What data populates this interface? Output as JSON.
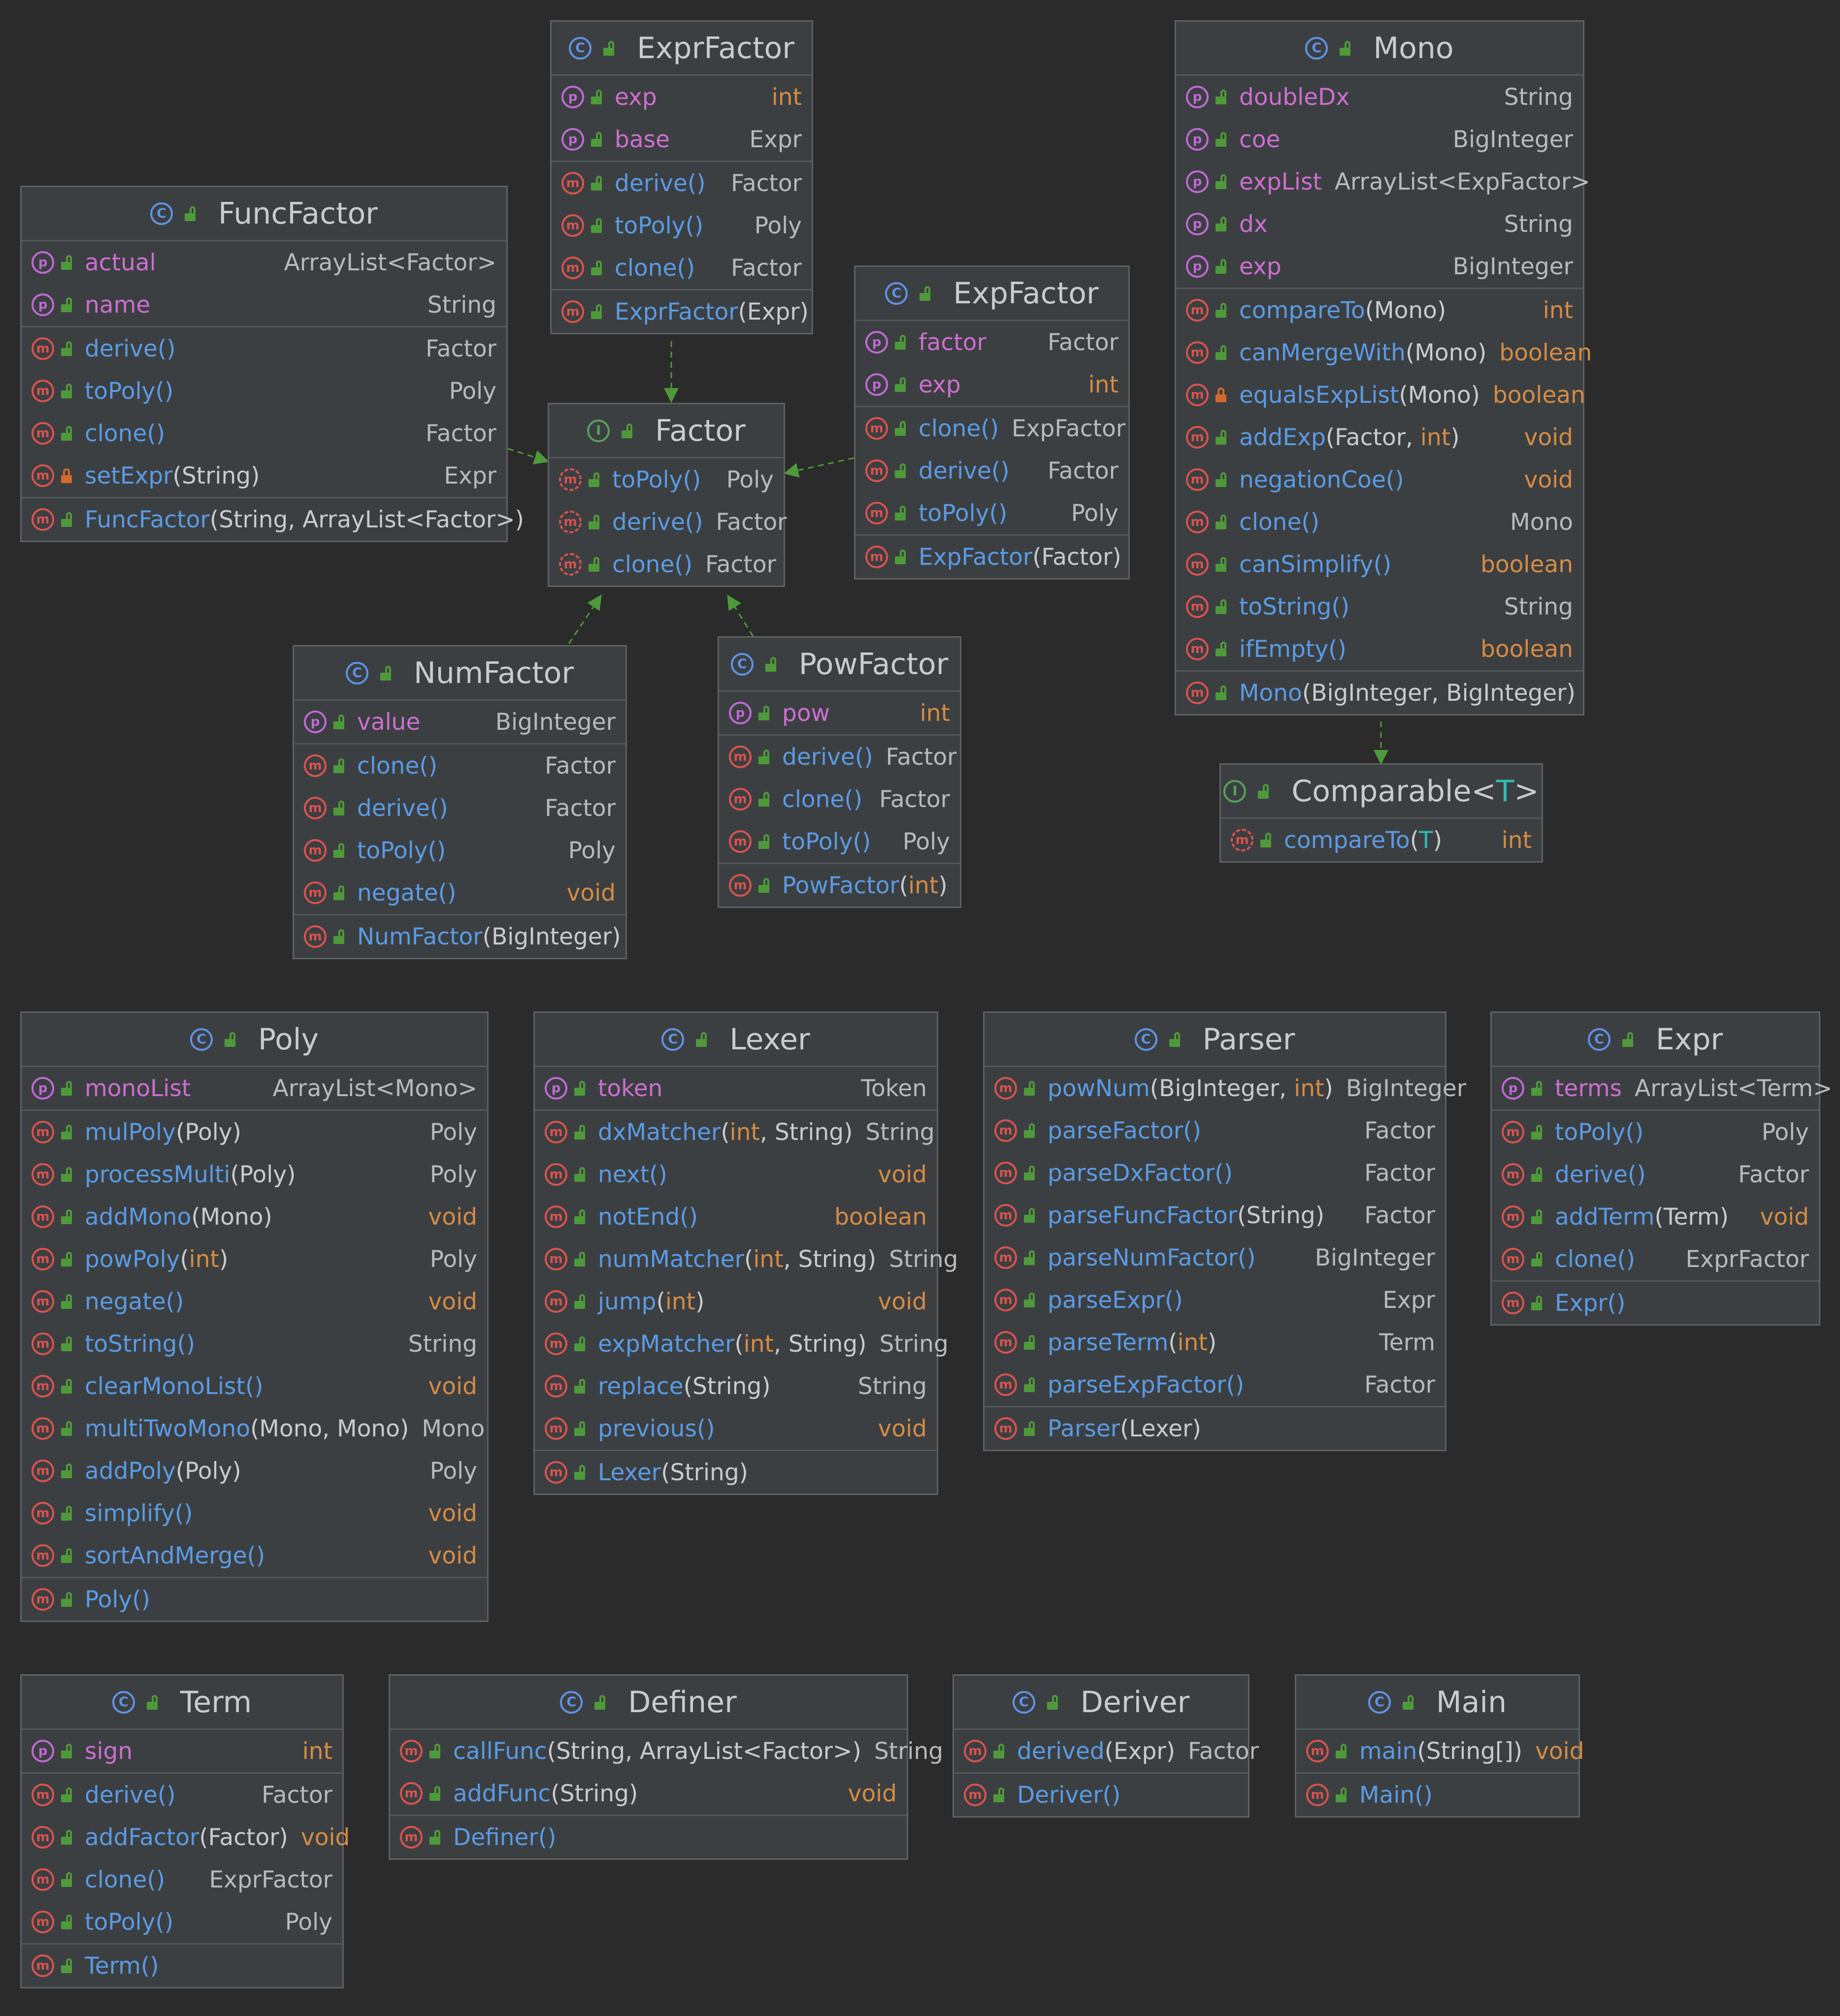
{
  "colors": {
    "background": "#2b2b2b",
    "node": "#3c3f41",
    "class_icon": "#5f93e6",
    "interface_icon": "#58a15a",
    "field_icon": "#c06ad6",
    "method_icon": "#d9534f",
    "method_name": "#5a9be5",
    "field_name": "#cd6fd0",
    "keyword": "#d58c45",
    "edge": "#4e9a3a"
  },
  "icons": {
    "class": "class-icon",
    "interface": "interface-icon",
    "field": "property-icon",
    "method": "method-icon",
    "public": "public-lock-icon",
    "private": "private-lock-icon"
  },
  "nodes": {
    "ExprFactor": {
      "kind": "class",
      "title": "ExprFactor",
      "sections": [
        [
          {
            "k": "p",
            "name": "exp",
            "type": "int"
          },
          {
            "k": "p",
            "name": "base",
            "type": "Expr"
          }
        ],
        [
          {
            "k": "m",
            "name": "derive()",
            "type": "Factor"
          },
          {
            "k": "m",
            "name": "toPoly()",
            "type": "Poly"
          },
          {
            "k": "m",
            "name": "clone()",
            "type": "Factor"
          }
        ],
        [
          {
            "k": "m",
            "name": "ExprFactor",
            "params": "(Expr)",
            "type": ""
          }
        ]
      ]
    },
    "Mono": {
      "kind": "class",
      "title": "Mono",
      "sections": [
        [
          {
            "k": "p",
            "name": "doubleDx",
            "type": "String"
          },
          {
            "k": "p",
            "name": "coe",
            "type": "BigInteger"
          },
          {
            "k": "p",
            "name": "expList",
            "type": "ArrayList<ExpFactor>"
          },
          {
            "k": "p",
            "name": "dx",
            "type": "String"
          },
          {
            "k": "p",
            "name": "exp",
            "type": "BigInteger"
          }
        ],
        [
          {
            "k": "m",
            "name": "compareTo",
            "params": "(Mono)",
            "type": "int"
          },
          {
            "k": "m",
            "name": "canMergeWith",
            "params": "(Mono)",
            "type": "boolean"
          },
          {
            "k": "m",
            "name": "equalsExpList",
            "params": "(Mono)",
            "type": "boolean",
            "private": true
          },
          {
            "k": "m",
            "name": "addExp",
            "params": "(Factor, int)",
            "type": "void"
          },
          {
            "k": "m",
            "name": "negationCoe()",
            "type": "void"
          },
          {
            "k": "m",
            "name": "clone()",
            "type": "Mono"
          },
          {
            "k": "m",
            "name": "canSimplify()",
            "type": "boolean"
          },
          {
            "k": "m",
            "name": "toString()",
            "type": "String"
          },
          {
            "k": "m",
            "name": "ifEmpty()",
            "type": "boolean"
          }
        ],
        [
          {
            "k": "m",
            "name": "Mono",
            "params": "(BigInteger, BigInteger)",
            "type": ""
          }
        ]
      ]
    },
    "FuncFactor": {
      "kind": "class",
      "title": "FuncFactor",
      "sections": [
        [
          {
            "k": "p",
            "name": "actual",
            "type": "ArrayList<Factor>"
          },
          {
            "k": "p",
            "name": "name",
            "type": "String"
          }
        ],
        [
          {
            "k": "m",
            "name": "derive()",
            "type": "Factor"
          },
          {
            "k": "m",
            "name": "toPoly()",
            "type": "Poly"
          },
          {
            "k": "m",
            "name": "clone()",
            "type": "Factor"
          },
          {
            "k": "m",
            "name": "setExpr",
            "params": "(String)",
            "type": "Expr",
            "private": true
          }
        ],
        [
          {
            "k": "m",
            "name": "FuncFactor",
            "params": "(String, ArrayList<Factor>)",
            "type": ""
          }
        ]
      ]
    },
    "ExpFactor": {
      "kind": "class",
      "title": "ExpFactor",
      "sections": [
        [
          {
            "k": "p",
            "name": "factor",
            "type": "Factor"
          },
          {
            "k": "p",
            "name": "exp",
            "type": "int"
          }
        ],
        [
          {
            "k": "m",
            "name": "clone()",
            "type": "ExpFactor"
          },
          {
            "k": "m",
            "name": "derive()",
            "type": "Factor"
          },
          {
            "k": "m",
            "name": "toPoly()",
            "type": "Poly"
          }
        ],
        [
          {
            "k": "m",
            "name": "ExpFactor",
            "params": "(Factor)",
            "type": ""
          }
        ]
      ]
    },
    "Factor": {
      "kind": "interface",
      "title": "Factor",
      "sections": [
        [
          {
            "k": "m",
            "name": "toPoly()",
            "type": "Poly",
            "abstract": true
          },
          {
            "k": "m",
            "name": "derive()",
            "type": "Factor",
            "abstract": true
          },
          {
            "k": "m",
            "name": "clone()",
            "type": "Factor",
            "abstract": true
          }
        ]
      ]
    },
    "NumFactor": {
      "kind": "class",
      "title": "NumFactor",
      "sections": [
        [
          {
            "k": "p",
            "name": "value",
            "type": "BigInteger"
          }
        ],
        [
          {
            "k": "m",
            "name": "clone()",
            "type": "Factor"
          },
          {
            "k": "m",
            "name": "derive()",
            "type": "Factor"
          },
          {
            "k": "m",
            "name": "toPoly()",
            "type": "Poly"
          },
          {
            "k": "m",
            "name": "negate()",
            "type": "void"
          }
        ],
        [
          {
            "k": "m",
            "name": "NumFactor",
            "params": "(BigInteger)",
            "type": ""
          }
        ]
      ]
    },
    "PowFactor": {
      "kind": "class",
      "title": "PowFactor",
      "sections": [
        [
          {
            "k": "p",
            "name": "pow",
            "type": "int"
          }
        ],
        [
          {
            "k": "m",
            "name": "derive()",
            "type": "Factor"
          },
          {
            "k": "m",
            "name": "clone()",
            "type": "Factor"
          },
          {
            "k": "m",
            "name": "toPoly()",
            "type": "Poly"
          }
        ],
        [
          {
            "k": "m",
            "name": "PowFactor",
            "params": "(int)",
            "type": ""
          }
        ]
      ]
    },
    "Comparable": {
      "kind": "interface",
      "title": "Comparable<",
      "tparam": "T",
      "title_end": ">",
      "sections": [
        [
          {
            "k": "m",
            "name": "compareTo",
            "params": "(T)",
            "type": "int",
            "abstract": true
          }
        ]
      ]
    },
    "Poly": {
      "kind": "class",
      "title": "Poly",
      "sections": [
        [
          {
            "k": "p",
            "name": "monoList",
            "type": "ArrayList<Mono>"
          }
        ],
        [
          {
            "k": "m",
            "name": "mulPoly",
            "params": "(Poly)",
            "type": "Poly"
          },
          {
            "k": "m",
            "name": "processMulti",
            "params": "(Poly)",
            "type": "Poly"
          },
          {
            "k": "m",
            "name": "addMono",
            "params": "(Mono)",
            "type": "void"
          },
          {
            "k": "m",
            "name": "powPoly",
            "params": "(int)",
            "type": "Poly"
          },
          {
            "k": "m",
            "name": "negate()",
            "type": "void"
          },
          {
            "k": "m",
            "name": "toString()",
            "type": "String"
          },
          {
            "k": "m",
            "name": "clearMonoList()",
            "type": "void"
          },
          {
            "k": "m",
            "name": "multiTwoMono",
            "params": "(Mono, Mono)",
            "type": "Mono"
          },
          {
            "k": "m",
            "name": "addPoly",
            "params": "(Poly)",
            "type": "Poly"
          },
          {
            "k": "m",
            "name": "simplify()",
            "type": "void"
          },
          {
            "k": "m",
            "name": "sortAndMerge()",
            "type": "void"
          }
        ],
        [
          {
            "k": "m",
            "name": "Poly()",
            "type": ""
          }
        ]
      ]
    },
    "Lexer": {
      "kind": "class",
      "title": "Lexer",
      "sections": [
        [
          {
            "k": "p",
            "name": "token",
            "type": "Token"
          }
        ],
        [
          {
            "k": "m",
            "name": "dxMatcher",
            "params": "(int, String)",
            "type": "String"
          },
          {
            "k": "m",
            "name": "next()",
            "type": "void"
          },
          {
            "k": "m",
            "name": "notEnd()",
            "type": "boolean"
          },
          {
            "k": "m",
            "name": "numMatcher",
            "params": "(int, String)",
            "type": "String"
          },
          {
            "k": "m",
            "name": "jump",
            "params": "(int)",
            "type": "void"
          },
          {
            "k": "m",
            "name": "expMatcher",
            "params": "(int, String)",
            "type": "String"
          },
          {
            "k": "m",
            "name": "replace",
            "params": "(String)",
            "type": "String"
          },
          {
            "k": "m",
            "name": "previous()",
            "type": "void"
          }
        ],
        [
          {
            "k": "m",
            "name": "Lexer",
            "params": "(String)",
            "type": ""
          }
        ]
      ]
    },
    "Parser": {
      "kind": "class",
      "title": "Parser",
      "sections": [
        [
          {
            "k": "m",
            "name": "powNum",
            "params": "(BigInteger, int)",
            "type": "BigInteger"
          },
          {
            "k": "m",
            "name": "parseFactor()",
            "type": "Factor"
          },
          {
            "k": "m",
            "name": "parseDxFactor()",
            "type": "Factor"
          },
          {
            "k": "m",
            "name": "parseFuncFactor",
            "params": "(String)",
            "type": "Factor"
          },
          {
            "k": "m",
            "name": "parseNumFactor()",
            "type": "BigInteger"
          },
          {
            "k": "m",
            "name": "parseExpr()",
            "type": "Expr"
          },
          {
            "k": "m",
            "name": "parseTerm",
            "params": "(int)",
            "type": "Term"
          },
          {
            "k": "m",
            "name": "parseExpFactor()",
            "type": "Factor"
          }
        ],
        [
          {
            "k": "m",
            "name": "Parser",
            "params": "(Lexer)",
            "type": ""
          }
        ]
      ]
    },
    "Expr": {
      "kind": "class",
      "title": "Expr",
      "sections": [
        [
          {
            "k": "p",
            "name": "terms",
            "type": "ArrayList<Term>"
          }
        ],
        [
          {
            "k": "m",
            "name": "toPoly()",
            "type": "Poly"
          },
          {
            "k": "m",
            "name": "derive()",
            "type": "Factor"
          },
          {
            "k": "m",
            "name": "addTerm",
            "params": "(Term)",
            "type": "void"
          },
          {
            "k": "m",
            "name": "clone()",
            "type": "ExprFactor"
          }
        ],
        [
          {
            "k": "m",
            "name": "Expr()",
            "type": ""
          }
        ]
      ]
    },
    "Term": {
      "kind": "class",
      "title": "Term",
      "sections": [
        [
          {
            "k": "p",
            "name": "sign",
            "type": "int"
          }
        ],
        [
          {
            "k": "m",
            "name": "derive()",
            "type": "Factor"
          },
          {
            "k": "m",
            "name": "addFactor",
            "params": "(Factor)",
            "type": "void"
          },
          {
            "k": "m",
            "name": "clone()",
            "type": "ExprFactor"
          },
          {
            "k": "m",
            "name": "toPoly()",
            "type": "Poly"
          }
        ],
        [
          {
            "k": "m",
            "name": "Term()",
            "type": ""
          }
        ]
      ]
    },
    "Definer": {
      "kind": "class",
      "title": "Definer",
      "sections": [
        [
          {
            "k": "m",
            "name": "callFunc",
            "params": "(String, ArrayList<Factor>)",
            "type": "String"
          },
          {
            "k": "m",
            "name": "addFunc",
            "params": "(String)",
            "type": "void"
          }
        ],
        [
          {
            "k": "m",
            "name": "Definer()",
            "type": ""
          }
        ]
      ]
    },
    "Deriver": {
      "kind": "class",
      "title": "Deriver",
      "sections": [
        [
          {
            "k": "m",
            "name": "derived",
            "params": "(Expr)",
            "type": "Factor"
          }
        ],
        [
          {
            "k": "m",
            "name": "Deriver()",
            "type": ""
          }
        ]
      ]
    },
    "Main": {
      "kind": "class",
      "title": "Main",
      "sections": [
        [
          {
            "k": "m",
            "name": "main",
            "params": "(String[])",
            "type": "void"
          }
        ],
        [
          {
            "k": "m",
            "name": "Main()",
            "type": ""
          }
        ]
      ]
    }
  },
  "edges": [
    {
      "from": "ExprFactor",
      "to": "Factor",
      "kind": "implements"
    },
    {
      "from": "FuncFactor",
      "to": "Factor",
      "kind": "implements"
    },
    {
      "from": "ExpFactor",
      "to": "Factor",
      "kind": "implements"
    },
    {
      "from": "NumFactor",
      "to": "Factor",
      "kind": "implements"
    },
    {
      "from": "PowFactor",
      "to": "Factor",
      "kind": "implements"
    },
    {
      "from": "Mono",
      "to": "Comparable",
      "kind": "implements"
    }
  ]
}
